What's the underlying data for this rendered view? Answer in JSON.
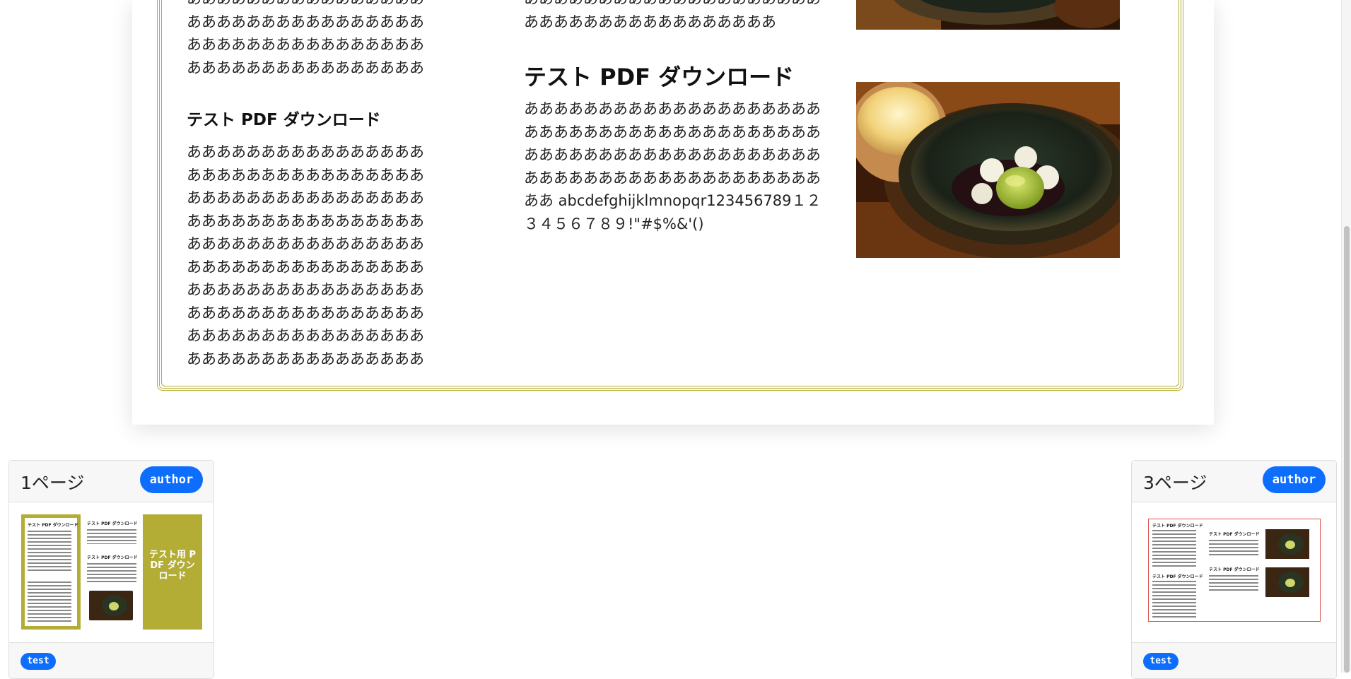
{
  "document": {
    "left_column_top_text": "あああああああああああああああああああああああああああああああああああああああああああああああああああああああああああああああああああああああ",
    "left_heading": "テスト PDF ダウンロード",
    "left_body_text": "ああああああああああああああああああああああああああああああああああああああああああああああああああああああああああああああああああああああああああああああああああああああああああああああああああああああああああああああああああああああああああああああああああああああああああああああああああああああああああああああああああああああああ",
    "mid_top_text": "あああああああああああああああああああああああああああああああああああああ",
    "mid_heading": "テスト PDF ダウンロード",
    "mid_body_text": "ああああああああああああああああああああああああああああああああああああああああああああああああああああああああああああああああああああああああああああああああああ abcdefghijklmnopqr123456789１２３４５６７８９!\"#$%&'()"
  },
  "cards": [
    {
      "title": "1ページ",
      "badge": "author",
      "tag": "test",
      "thumb_heading": "テスト PDF ダウンロード",
      "thumb_cover_text": "テスト用 PDF ダウンロード"
    },
    {
      "title": "3ページ",
      "badge": "author",
      "tag": "test",
      "thumb_heading": "テスト PDF ダウンロード"
    }
  ],
  "colors": {
    "frame": "#b3ad36",
    "badge": "#0d6efd",
    "selected_border": "#d9534f"
  }
}
